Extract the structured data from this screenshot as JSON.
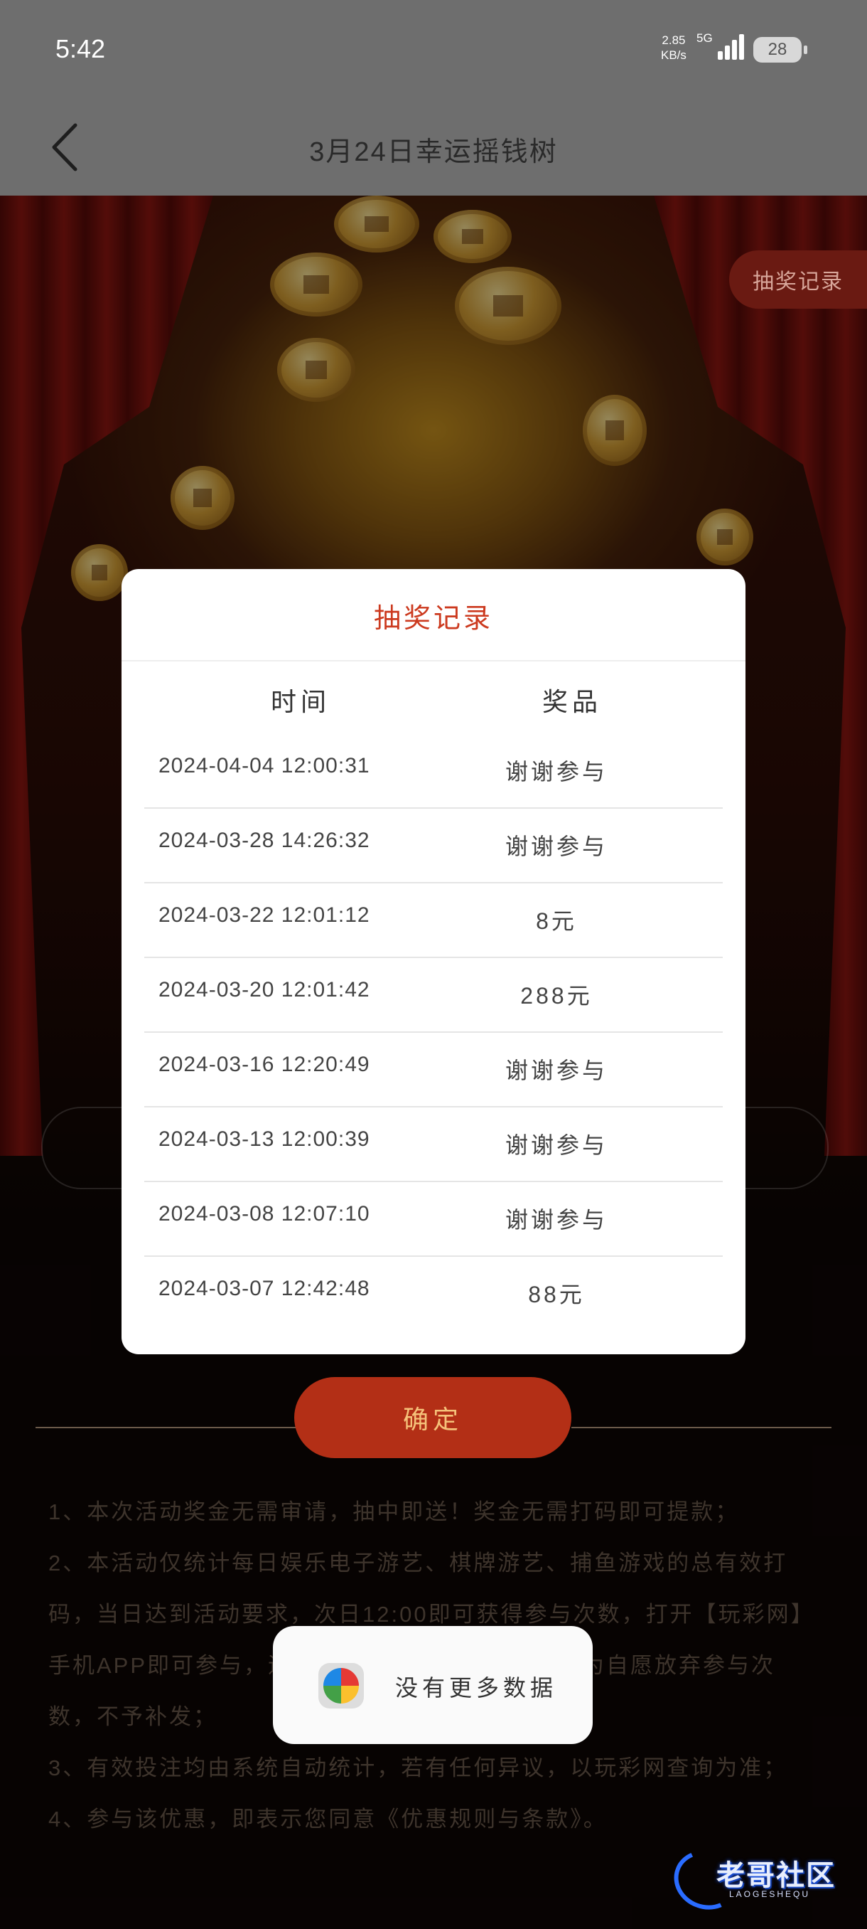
{
  "status_bar": {
    "time": "5:42",
    "net_speed_value": "2.85",
    "net_speed_unit": "KB/s",
    "network": "5G",
    "battery": "28"
  },
  "header": {
    "title": "3月24日幸运摇钱树"
  },
  "draw_record_button": "抽奖记录",
  "modal": {
    "title": "抽奖记录",
    "col_time": "时间",
    "col_prize": "奖品",
    "records": [
      {
        "time": "2024-04-04  12:00:31",
        "prize": "谢谢参与"
      },
      {
        "time": "2024-03-28  14:26:32",
        "prize": "谢谢参与"
      },
      {
        "time": "2024-03-22  12:01:12",
        "prize": "8元"
      },
      {
        "time": "2024-03-20  12:01:42",
        "prize": "288元"
      },
      {
        "time": "2024-03-16  12:20:49",
        "prize": "谢谢参与"
      },
      {
        "time": "2024-03-13  12:00:39",
        "prize": "谢谢参与"
      },
      {
        "time": "2024-03-08  12:07:10",
        "prize": "谢谢参与"
      },
      {
        "time": "2024-03-07  12:42:48",
        "prize": "88元"
      }
    ]
  },
  "confirm_button": "确定",
  "rules": [
    "1、本次活动奖金无需审请，抽中即送！奖金无需打码即可提款；",
    "2、本活动仅统计每日娱乐电子游艺、棋牌游艺、捕鱼游戏的总有效打码，当日达到活动要求，次日12:00即可获得参与次数，打开【玩彩网】手机APP即可参与，逾期未参与者，超过活动时视为自愿放弃参与次数，不予补发；",
    "3、有效投注均由系统自动统计，若有任何异议，以玩彩网查询为准；",
    "4、参与该优惠，即表示您同意《优惠规则与条款》。"
  ],
  "toast": {
    "message": "没有更多数据",
    "icon": "app-logo-icon"
  },
  "watermark": {
    "text": "老哥社区",
    "sub": "LAOGESHEQU"
  },
  "colors": {
    "accent_red": "#b32f16",
    "title_red": "#cc3a1f",
    "button_text_gold": "#f5c27a"
  }
}
